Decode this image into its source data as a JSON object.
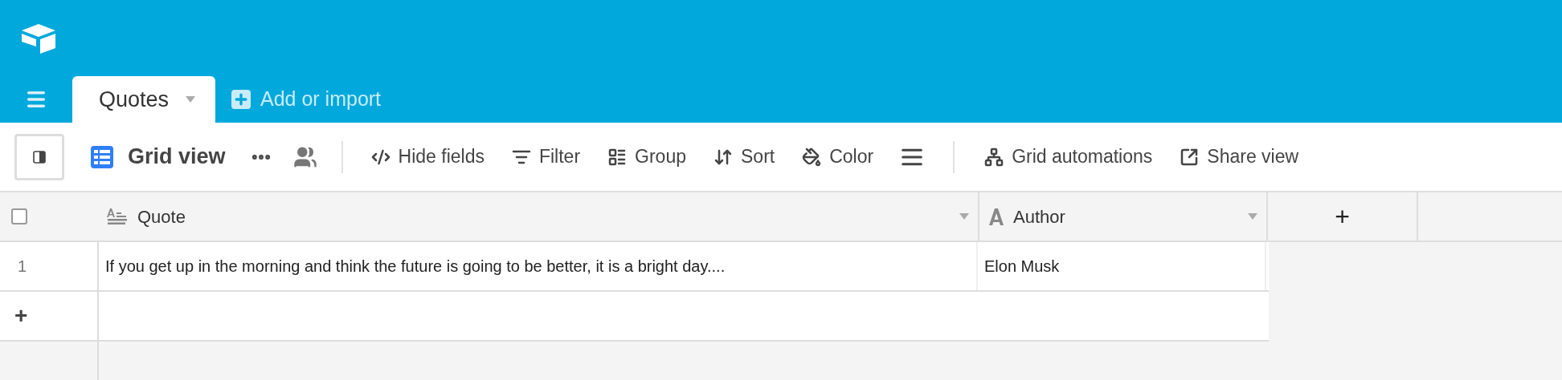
{
  "tabs": [
    {
      "label": "Quotes",
      "selected": true
    }
  ],
  "add_table": "Add or import",
  "view": {
    "name": "Grid view"
  },
  "toolbar": [
    {
      "kind": "hide",
      "label": "Hide fields"
    },
    {
      "kind": "filter",
      "label": "Filter"
    },
    {
      "kind": "group",
      "label": "Group"
    },
    {
      "kind": "sort",
      "label": "Sort"
    },
    {
      "kind": "color",
      "label": "Color"
    },
    {
      "kind": "height"
    },
    {
      "kind": "divider"
    },
    {
      "kind": "automations",
      "label": "Grid automations"
    },
    {
      "kind": "share",
      "label": "Share view"
    }
  ],
  "table": {
    "select_all_checked": false,
    "columns": [
      {
        "kind": "long_text",
        "name": "Quote"
      },
      {
        "kind": "text",
        "name": "Author"
      }
    ],
    "add_column": "+",
    "rows": [
      {
        "number": "1",
        "cells": [
          "If you get up in the morning and think the future is going to be better, it is a bright day....",
          "Elon Musk"
        ]
      }
    ],
    "add_row": "+"
  }
}
